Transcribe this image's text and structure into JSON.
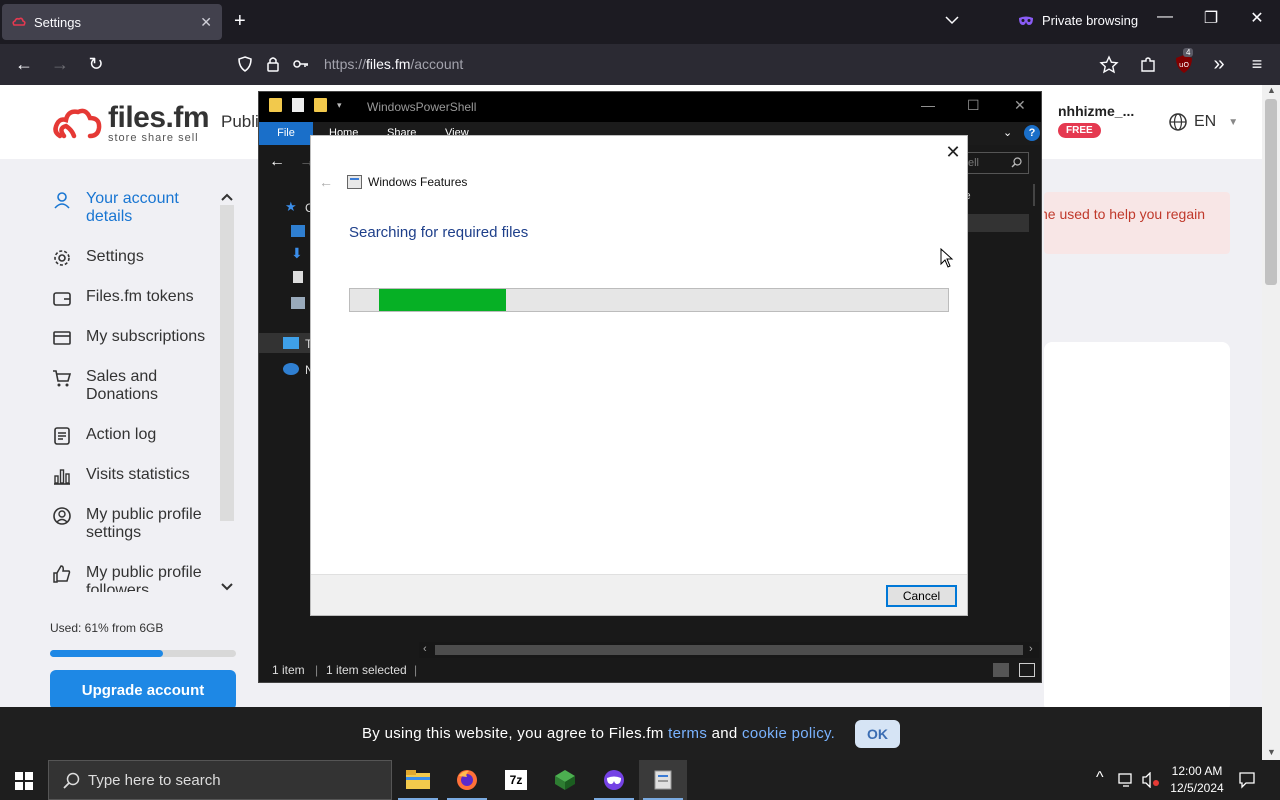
{
  "browser": {
    "tab_title": "Settings",
    "private_label": "Private browsing",
    "url_prefix": "https://",
    "url_host": "files.fm",
    "url_path": "/account",
    "extension_badge": "4"
  },
  "site": {
    "logo_brand": "files.fm",
    "logo_tagline": "store share sell",
    "nav_public": "Publi",
    "user_name": "nhhizme_...",
    "plan_badge": "FREE",
    "language": "EN",
    "sidebar": [
      {
        "label": "Your account details",
        "icon": "person-icon",
        "active": true
      },
      {
        "label": "Settings",
        "icon": "gear-icon"
      },
      {
        "label": "Files.fm tokens",
        "icon": "wallet-icon"
      },
      {
        "label": "My subscriptions",
        "icon": "card-icon"
      },
      {
        "label": "Sales and Donations",
        "icon": "cart-icon"
      },
      {
        "label": "Action log",
        "icon": "log-icon"
      },
      {
        "label": "Visits statistics",
        "icon": "chart-icon"
      },
      {
        "label": "My public profile settings",
        "icon": "profile-icon"
      },
      {
        "label": "My public profile followers",
        "icon": "thumbs-up-icon"
      }
    ],
    "storage_text": "Used: 61% from 6GB",
    "storage_fraction": 0.61,
    "upgrade_label": "Upgrade account",
    "alert_text": "ne used to help you regain",
    "cookie": {
      "text_before": "By using this website, you agree to Files.fm",
      "terms": "terms",
      "and": "and",
      "policy": "cookie policy.",
      "ok_label": "OK"
    }
  },
  "explorer": {
    "title": "WindowsPowerShell",
    "ribbon_file": "File",
    "ribbon_tabs": [
      "Home",
      "Share",
      "View"
    ],
    "search_placeholder": "ell",
    "column_header": "ze",
    "nav_labels": [
      "C",
      "T",
      "N"
    ],
    "status_items": "1 item",
    "status_selected": "1 item selected"
  },
  "dialog": {
    "title": "Windows Features",
    "heading": "Searching for required files",
    "progress_start": 0.048,
    "progress_end": 0.26,
    "cancel_label": "Cancel"
  },
  "taskbar": {
    "search_placeholder": "Type here to search",
    "time": "12:00 AM",
    "date": "12/5/2024"
  }
}
